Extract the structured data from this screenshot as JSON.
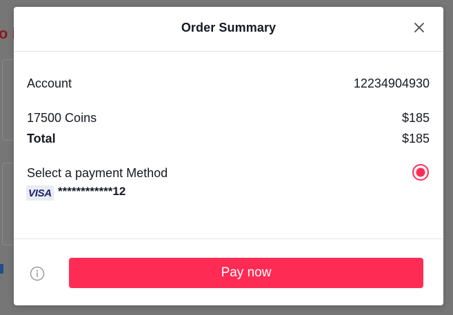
{
  "background": {
    "heading_fragment": "o i"
  },
  "modal": {
    "title": "Order Summary",
    "close_icon": "close-icon"
  },
  "summary": {
    "account_label": "Account",
    "account_value": "12234904930",
    "item_label": "17500 Coins",
    "item_price": "$185",
    "total_label": "Total",
    "total_value": "$185"
  },
  "payment": {
    "label": "Select a payment Method",
    "card_brand": "VISA",
    "card_number": "************12",
    "selected": true
  },
  "footer": {
    "info_icon": "info-icon",
    "pay_button_label": "Pay now"
  },
  "colors": {
    "accent": "#fe2c55",
    "text": "#161823",
    "visa": "#1a1f71"
  }
}
